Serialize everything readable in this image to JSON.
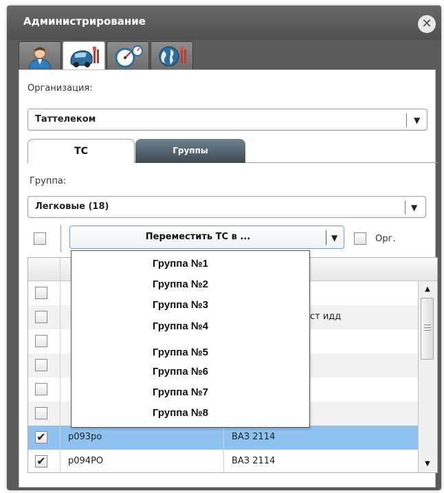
{
  "window": {
    "title": "Администрирование",
    "close_icon": "close-icon"
  },
  "icon_tabs": [
    {
      "name": "users",
      "icon": "user-icon",
      "active": false
    },
    {
      "name": "vehicles",
      "icon": "car-tools-icon",
      "active": true
    },
    {
      "name": "sensors",
      "icon": "gauge-icon",
      "active": false
    },
    {
      "name": "geo",
      "icon": "globe-tools-icon",
      "active": false
    }
  ],
  "organization": {
    "label": "Организация:",
    "value": "Таттелеком"
  },
  "tabs": {
    "vehicles": "ТС",
    "groups": "Группы"
  },
  "group": {
    "label": "Группа:",
    "value": "Легковые (18)"
  },
  "toolbar": {
    "move_label": "Переместить ТС в ...",
    "org_label": "Орг."
  },
  "grid": {
    "hidden_cell_fragment": "ст идд",
    "rows": [
      {
        "checked": false,
        "plate": "",
        "model": ""
      },
      {
        "checked": false,
        "plate": "",
        "model": ""
      },
      {
        "checked": false,
        "plate": "",
        "model": ""
      },
      {
        "checked": false,
        "plate": "",
        "model": ""
      },
      {
        "checked": false,
        "plate": "",
        "model": ""
      },
      {
        "checked": false,
        "plate": "",
        "model": ""
      },
      {
        "checked": true,
        "plate": "р093ро",
        "model": "ВАЗ 2114"
      },
      {
        "checked": true,
        "plate": "р094РО",
        "model": "ВАЗ 2114"
      }
    ]
  },
  "dropdown_options": [
    "Группа №1",
    "Группа №2",
    "Группа №3",
    "Группа №4",
    "Группа №5",
    "Группа №6",
    "Группа №7",
    "Группа №8"
  ],
  "colors": {
    "titlebar": "#5b5b5b",
    "selected_row": "#8fc2ee",
    "inactive_tab": "#4f5e69"
  }
}
